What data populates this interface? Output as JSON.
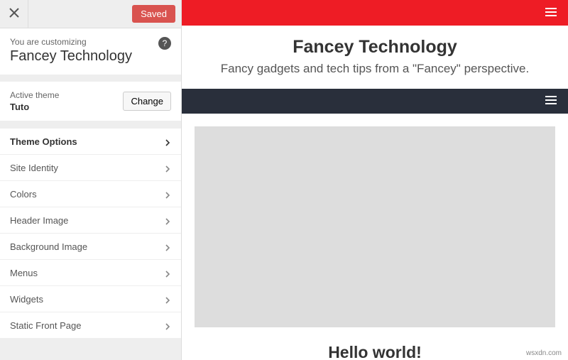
{
  "sidebar": {
    "saved_label": "Saved",
    "customizing_label": "You are customizing",
    "site_name": "Fancey Technology",
    "help_char": "?",
    "active_theme_label": "Active theme",
    "active_theme_name": "Tuto",
    "change_label": "Change",
    "panels": [
      {
        "label": "Theme Options",
        "bold": true
      },
      {
        "label": "Site Identity",
        "bold": false
      },
      {
        "label": "Colors",
        "bold": false
      },
      {
        "label": "Header Image",
        "bold": false
      },
      {
        "label": "Background Image",
        "bold": false
      },
      {
        "label": "Menus",
        "bold": false
      },
      {
        "label": "Widgets",
        "bold": false
      },
      {
        "label": "Static Front Page",
        "bold": false
      }
    ]
  },
  "preview": {
    "brand_title": "Fancey Technology",
    "brand_sub": "Fancy gadgets and tech tips from a \"Fancey\" perspective.",
    "post_title": "Hello world!",
    "colors": {
      "accent_red": "#ee1c25",
      "dark_nav": "#292f3b"
    }
  },
  "watermark": "wsxdn.com"
}
